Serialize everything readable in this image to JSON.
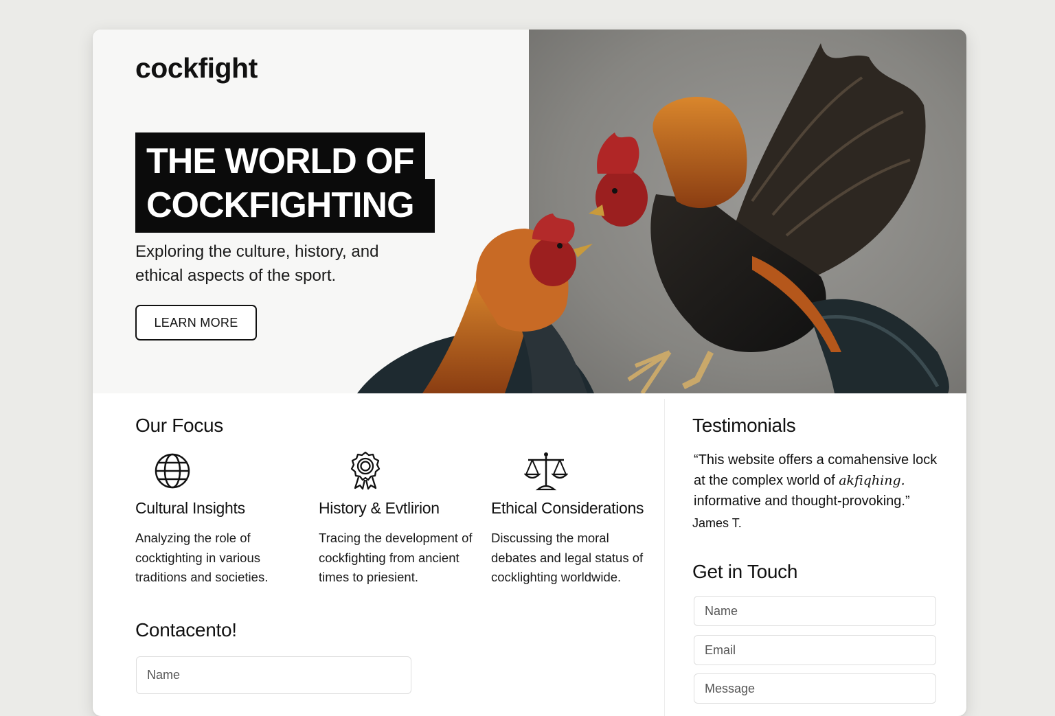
{
  "header": {
    "brand": "cockfight",
    "title_line1": "THE WORLD OF",
    "title_line2": "COCKFIGHTING",
    "subtitle": "Exploring the culture, history, and ethical aspects of the sport.",
    "cta_label": "LEARN MORE"
  },
  "focus": {
    "heading": "Our Focus",
    "items": [
      {
        "icon": "globe-icon",
        "title": "Cultural Insights",
        "desc": "Analyzing the role of cocktighting in various traditions and societies."
      },
      {
        "icon": "award-ribbon-icon",
        "title": "History & Evtlirion",
        "desc": "Tracing the development of cockfighting from ancient times to priesient."
      },
      {
        "icon": "scales-icon",
        "title": "Ethical Considerations",
        "desc": "Discussing the moral debates and legal status of cocklighting worldwide."
      }
    ]
  },
  "contact_left": {
    "heading": "Contacento!",
    "name_placeholder": "Name"
  },
  "testimonials": {
    "heading": "Testimonials",
    "quote_part1": "“This website offers a comahensive lock at the complex world of",
    "quote_script": "akfiqhing.",
    "quote_part2": "informative and thought-provoking.”",
    "author": "James T."
  },
  "contact_right": {
    "heading": "Get in Touch",
    "name_placeholder": "Name",
    "email_placeholder": "Email",
    "message_placeholder": "Message"
  },
  "colors": {
    "page_bg": "#ebebe8",
    "card_bg": "#ffffff",
    "hero_left_bg": "#f7f7f6",
    "title_bg": "#0b0b0b",
    "photo_bg": "#8c8b88"
  }
}
